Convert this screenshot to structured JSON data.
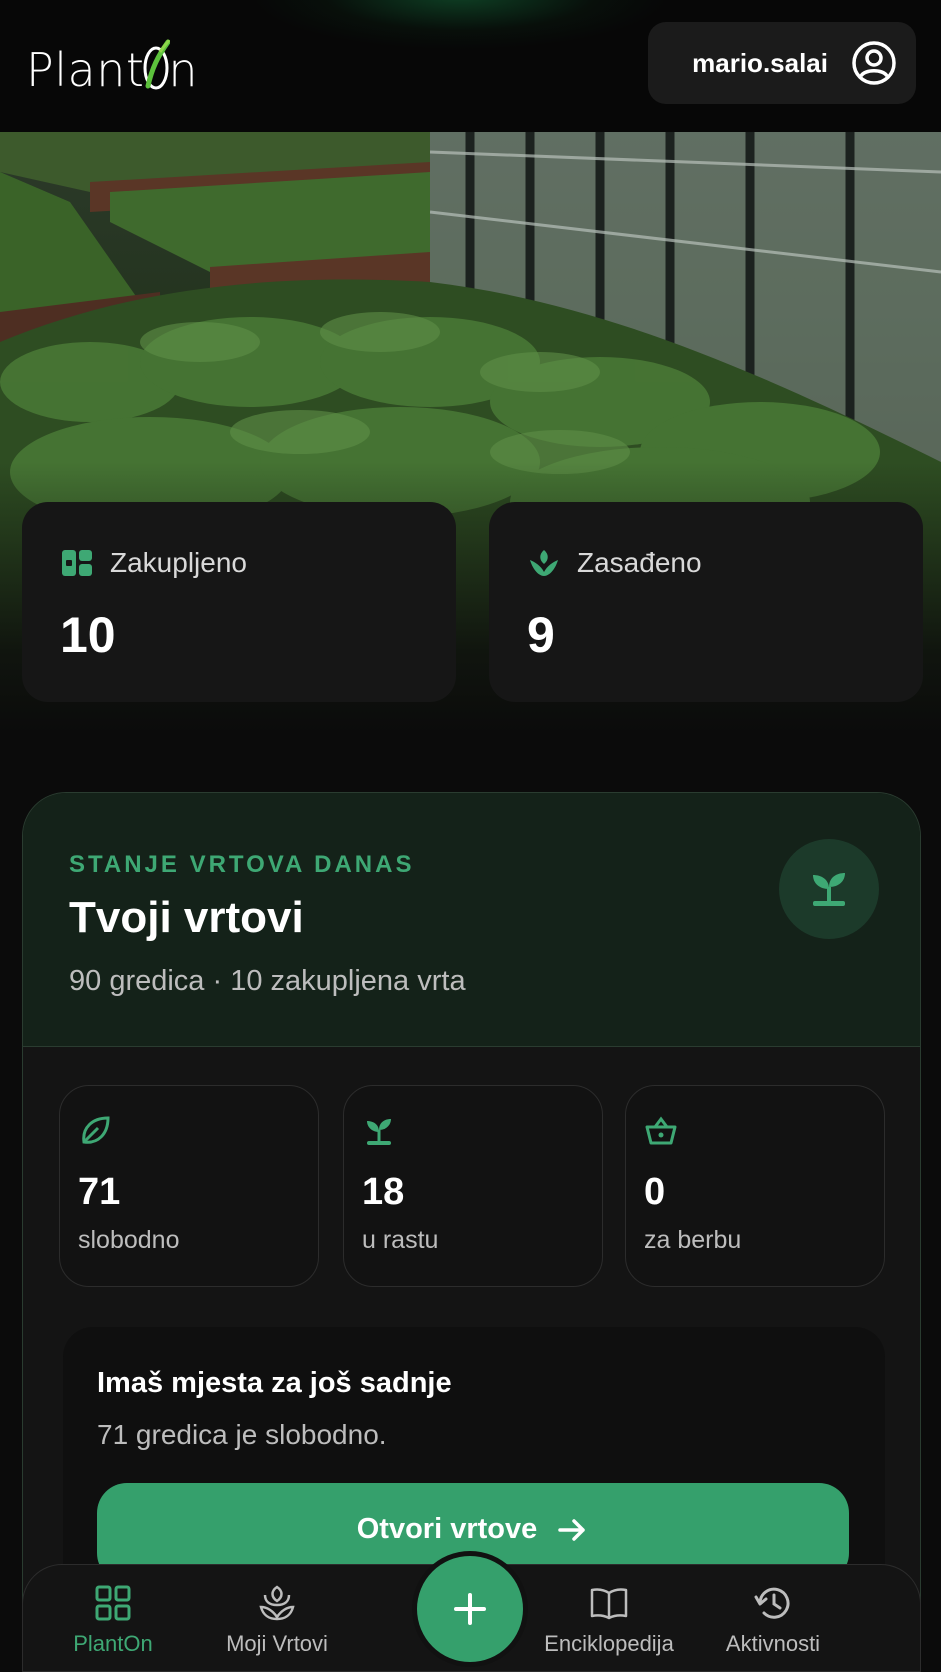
{
  "app": {
    "logo_text_left": "Plant",
    "logo_text_right": "n",
    "user_name": "mario.salai"
  },
  "colors": {
    "accent": "#35a06c",
    "accent_text": "#3ea874",
    "background": "#0b0b0b",
    "card": "#161616"
  },
  "stats": [
    {
      "label": "Zakupljeno",
      "value": "10",
      "icon": "dashboard-icon"
    },
    {
      "label": "Zasađeno",
      "value": "9",
      "icon": "sprout-icon"
    }
  ],
  "garden_status": {
    "eyebrow": "STANJE VRTOVA DANAS",
    "title": "Tvoji vrtovi",
    "subtitle": "90 gredica · 10 zakupljena vrta",
    "icon": "seedling-icon",
    "metrics": [
      {
        "value": "71",
        "label": "slobodno",
        "icon": "leaf-icon"
      },
      {
        "value": "18",
        "label": "u rastu",
        "icon": "seedling-icon"
      },
      {
        "value": "0",
        "label": "za berbu",
        "icon": "basket-icon"
      }
    ],
    "info": {
      "title": "Imaš mjesta za još sadnje",
      "subtitle": "71 gredica je slobodno.",
      "cta_label": "Otvori vrtove"
    }
  },
  "bottom_nav": [
    {
      "label": "PlantOn",
      "icon": "grid-icon",
      "active": true
    },
    {
      "label": "Moji Vrtovi",
      "icon": "flower-icon",
      "active": false
    },
    {
      "label": "Enciklopedija",
      "icon": "book-icon",
      "active": false
    },
    {
      "label": "Aktivnosti",
      "icon": "history-icon",
      "active": false
    }
  ],
  "fab": {
    "icon": "plus-icon"
  }
}
